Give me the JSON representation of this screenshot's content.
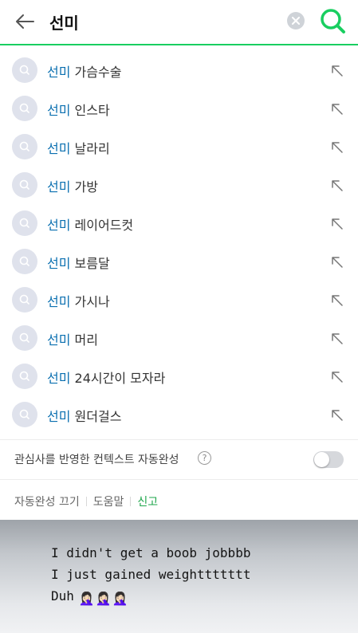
{
  "search": {
    "query": "선미",
    "back_icon": "arrow-left-icon",
    "clear_icon": "clear-x-icon",
    "search_icon": "search-icon",
    "accent_color": "#19ce60"
  },
  "suggestions": [
    {
      "match": "선미",
      "rest": " 가슴수술"
    },
    {
      "match": "선미",
      "rest": " 인스타"
    },
    {
      "match": "선미",
      "rest": " 날라리"
    },
    {
      "match": "선미",
      "rest": " 가방"
    },
    {
      "match": "선미",
      "rest": " 레이어드컷"
    },
    {
      "match": "선미",
      "rest": " 보름달"
    },
    {
      "match": "선미",
      "rest": " 가시나"
    },
    {
      "match": "선미",
      "rest": " 머리"
    },
    {
      "match": "선미",
      "rest": " 24시간이 모자라"
    },
    {
      "match": "선미",
      "rest": " 원더걸스"
    }
  ],
  "context_setting": {
    "label": "관심사를 반영한 컨텍스트 자동완성",
    "help": "?",
    "enabled": false
  },
  "footer": {
    "turn_off": "자동완성 끄기",
    "help": "도움말",
    "report": "신고"
  },
  "story_caption": {
    "line1": "I didn't get a boob jobbbb",
    "line2": "I just gained weighttttttt",
    "line3": "Duh",
    "emoji": "🤦🏻‍♀️"
  }
}
